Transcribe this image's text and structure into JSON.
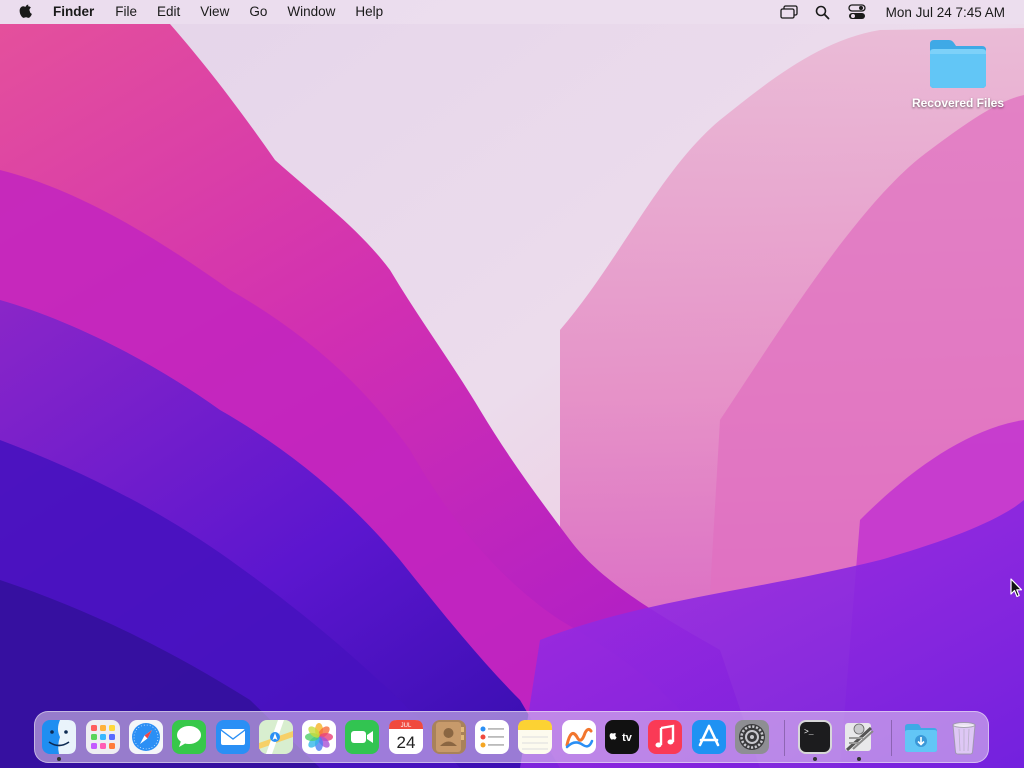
{
  "menubar": {
    "app_name": "Finder",
    "menus": [
      "File",
      "Edit",
      "View",
      "Go",
      "Window",
      "Help"
    ],
    "status_icons": [
      "screen-mirroring-icon",
      "spotlight-search-icon",
      "control-center-icon"
    ],
    "clock": "Mon Jul 24  7:45 AM"
  },
  "desktop": {
    "items": [
      {
        "label": "Recovered Files",
        "icon": "folder-icon"
      }
    ]
  },
  "dock": {
    "apps": [
      {
        "name": "Finder",
        "icon": "finder-icon",
        "running": true
      },
      {
        "name": "Launchpad",
        "icon": "launchpad-icon",
        "running": false
      },
      {
        "name": "Safari",
        "icon": "safari-icon",
        "running": false
      },
      {
        "name": "Messages",
        "icon": "messages-icon",
        "running": false
      },
      {
        "name": "Mail",
        "icon": "mail-icon",
        "running": false
      },
      {
        "name": "Maps",
        "icon": "maps-icon",
        "running": false
      },
      {
        "name": "Photos",
        "icon": "photos-icon",
        "running": false
      },
      {
        "name": "FaceTime",
        "icon": "facetime-icon",
        "running": false
      },
      {
        "name": "Calendar",
        "icon": "calendar-icon",
        "running": false,
        "month": "JUL",
        "day": "24"
      },
      {
        "name": "Contacts",
        "icon": "contacts-icon",
        "running": false
      },
      {
        "name": "Reminders",
        "icon": "reminders-icon",
        "running": false
      },
      {
        "name": "Notes",
        "icon": "notes-icon",
        "running": false
      },
      {
        "name": "Freeform",
        "icon": "freeform-icon",
        "running": false
      },
      {
        "name": "TV",
        "icon": "apple-tv-icon",
        "running": false,
        "label": "tv"
      },
      {
        "name": "Music",
        "icon": "music-icon",
        "running": false
      },
      {
        "name": "App Store",
        "icon": "app-store-icon",
        "running": false
      },
      {
        "name": "System Settings",
        "icon": "system-settings-icon",
        "running": false
      },
      {
        "name": "Terminal",
        "icon": "terminal-icon",
        "running": true,
        "label": ">_"
      },
      {
        "name": "Script Editor",
        "icon": "script-editor-icon",
        "running": true
      },
      {
        "name": "Downloads",
        "icon": "downloads-folder-icon",
        "running": false
      },
      {
        "name": "Trash",
        "icon": "trash-icon",
        "running": false
      }
    ]
  },
  "colors": {
    "folder_blue": "#5ec4f5",
    "wallpaper_pink": "#d838b4",
    "wallpaper_purple": "#5a18d0",
    "wallpaper_light": "#e8dceb"
  }
}
